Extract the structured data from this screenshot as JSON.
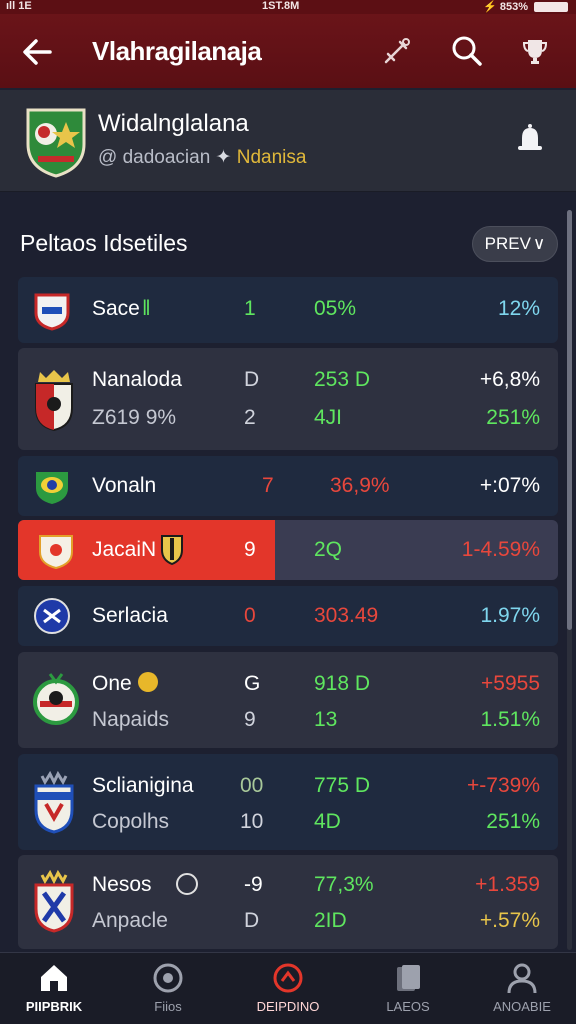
{
  "status": {
    "left": "ıll 1E",
    "time": "1ST.8M",
    "right": "⚡ 853%"
  },
  "header": {
    "title": "Vlahragilanaja"
  },
  "profile": {
    "name": "Widalnglalana",
    "handle": "@ dadoacian",
    "tag": "Ndanisa"
  },
  "section": {
    "title": "Peltaos Idsetiles",
    "button": "PREV"
  },
  "colors": {
    "header": "#5f1116",
    "up": "#5fe65f",
    "down": "#e8473c",
    "neutral": "#7fd6ee",
    "accent": "#e3362a"
  },
  "rows": [
    {
      "team": "Sace",
      "num": "1",
      "pct": "05%",
      "chg": "12%"
    },
    {
      "team": "Nanaloda",
      "team2": "Z619 9%",
      "num": "D",
      "num2": "2",
      "pct": "253 D",
      "pct2": "4JI",
      "chg": "+6,8%",
      "chg2": "251%"
    },
    {
      "team": "Vonaln",
      "num": "7",
      "pct": "36,9%",
      "chg": "+:07%"
    },
    {
      "team": "JacaiN",
      "num": "9",
      "pct": "2Q",
      "chg": "1-4.59%"
    },
    {
      "team": "Serlacia",
      "num": "0",
      "pct": "303.49",
      "chg": "1.97%"
    },
    {
      "team": "One",
      "team2": "Napaids",
      "num": "G",
      "num2": "9",
      "pct": "918 D",
      "pct2": "13",
      "chg": "+5955",
      "chg2": "1.51%"
    },
    {
      "team": "Sclianigina",
      "team2": "Copolhs",
      "num": "00",
      "num2": "10",
      "pct": "775 D",
      "pct2": "4D",
      "chg": "+-739%",
      "chg2": "251%"
    },
    {
      "team": "Nesos",
      "team2": "Anpacle",
      "num": "-9",
      "num2": "D",
      "pct": "77,3%",
      "pct2": "2ID",
      "chg": "+1.359",
      "chg2": "+.57%"
    }
  ],
  "tabs": [
    {
      "label": "PIIPBRIK",
      "icon": "home-icon"
    },
    {
      "label": "Fiios",
      "icon": "ball-icon"
    },
    {
      "label": "DEIPDINO",
      "icon": "target-icon"
    },
    {
      "label": "LAEOS",
      "icon": "cards-icon"
    },
    {
      "label": "ANOABIE",
      "icon": "user-icon"
    }
  ]
}
